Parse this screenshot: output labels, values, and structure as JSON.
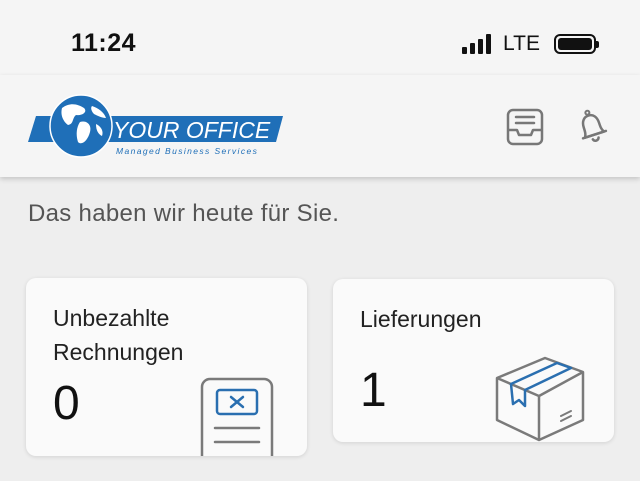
{
  "status_bar": {
    "time": "11:24",
    "network": "LTE",
    "signal_icon": "cellular-signal-icon",
    "battery_icon": "battery-full-icon"
  },
  "header": {
    "logo": {
      "title": "YOUR OFFICE",
      "tagline": "Managed Business Services",
      "icon": "globe-icon",
      "brand_color": "#1f6fb8"
    },
    "actions": [
      {
        "icon": "inbox-icon"
      },
      {
        "icon": "bell-icon"
      }
    ]
  },
  "greeting": "Das haben wir heute für Sie.",
  "cards": [
    {
      "title_line1": "Unbezahlte",
      "title_line2": "Rechnungen",
      "value": "0",
      "icon": "invoice-icon",
      "accent": "#2a6fb0"
    },
    {
      "title": "Lieferungen",
      "value": "1",
      "icon": "package-icon",
      "accent": "#2a6fb0"
    }
  ]
}
